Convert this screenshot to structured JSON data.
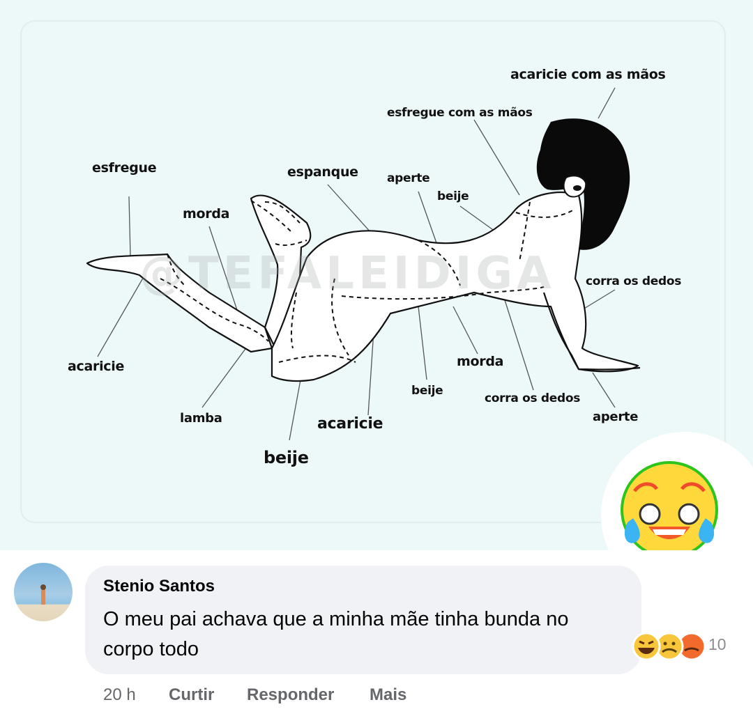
{
  "image": {
    "labels": {
      "top_right": "acaricie com as mãos",
      "rub_hands": "esfregue com as mãos",
      "rub": "esfregue",
      "spank": "espanque",
      "squeeze_top": "aperte",
      "kiss_top": "beije",
      "bite_top": "morda",
      "fingers_right": "corra os dedos",
      "caress_left": "acaricie",
      "lick": "lamba",
      "kiss_bottom": "beije",
      "caress_bottom": "acaricie",
      "kiss_middle": "beije",
      "bite_middle": "morda",
      "fingers_bottom": "corra os dedos",
      "squeeze_bottom": "aperte"
    },
    "watermark": "@TEFALEIDIGA"
  },
  "comment": {
    "author": "Stenio Santos",
    "text": "O meu pai achava que a minha mãe tinha bunda no corpo todo",
    "reaction_count": "10",
    "reactions": [
      "laughing-emoji",
      "sad-emoji",
      "angry-emoji"
    ]
  },
  "actions": {
    "timestamp": "20 h",
    "like": "Curtir",
    "reply": "Responder",
    "more": "Mais"
  },
  "colors": {
    "image_background": "#edf8f9",
    "bubble": "#f0f2f5",
    "secondary_text": "#65676b"
  }
}
